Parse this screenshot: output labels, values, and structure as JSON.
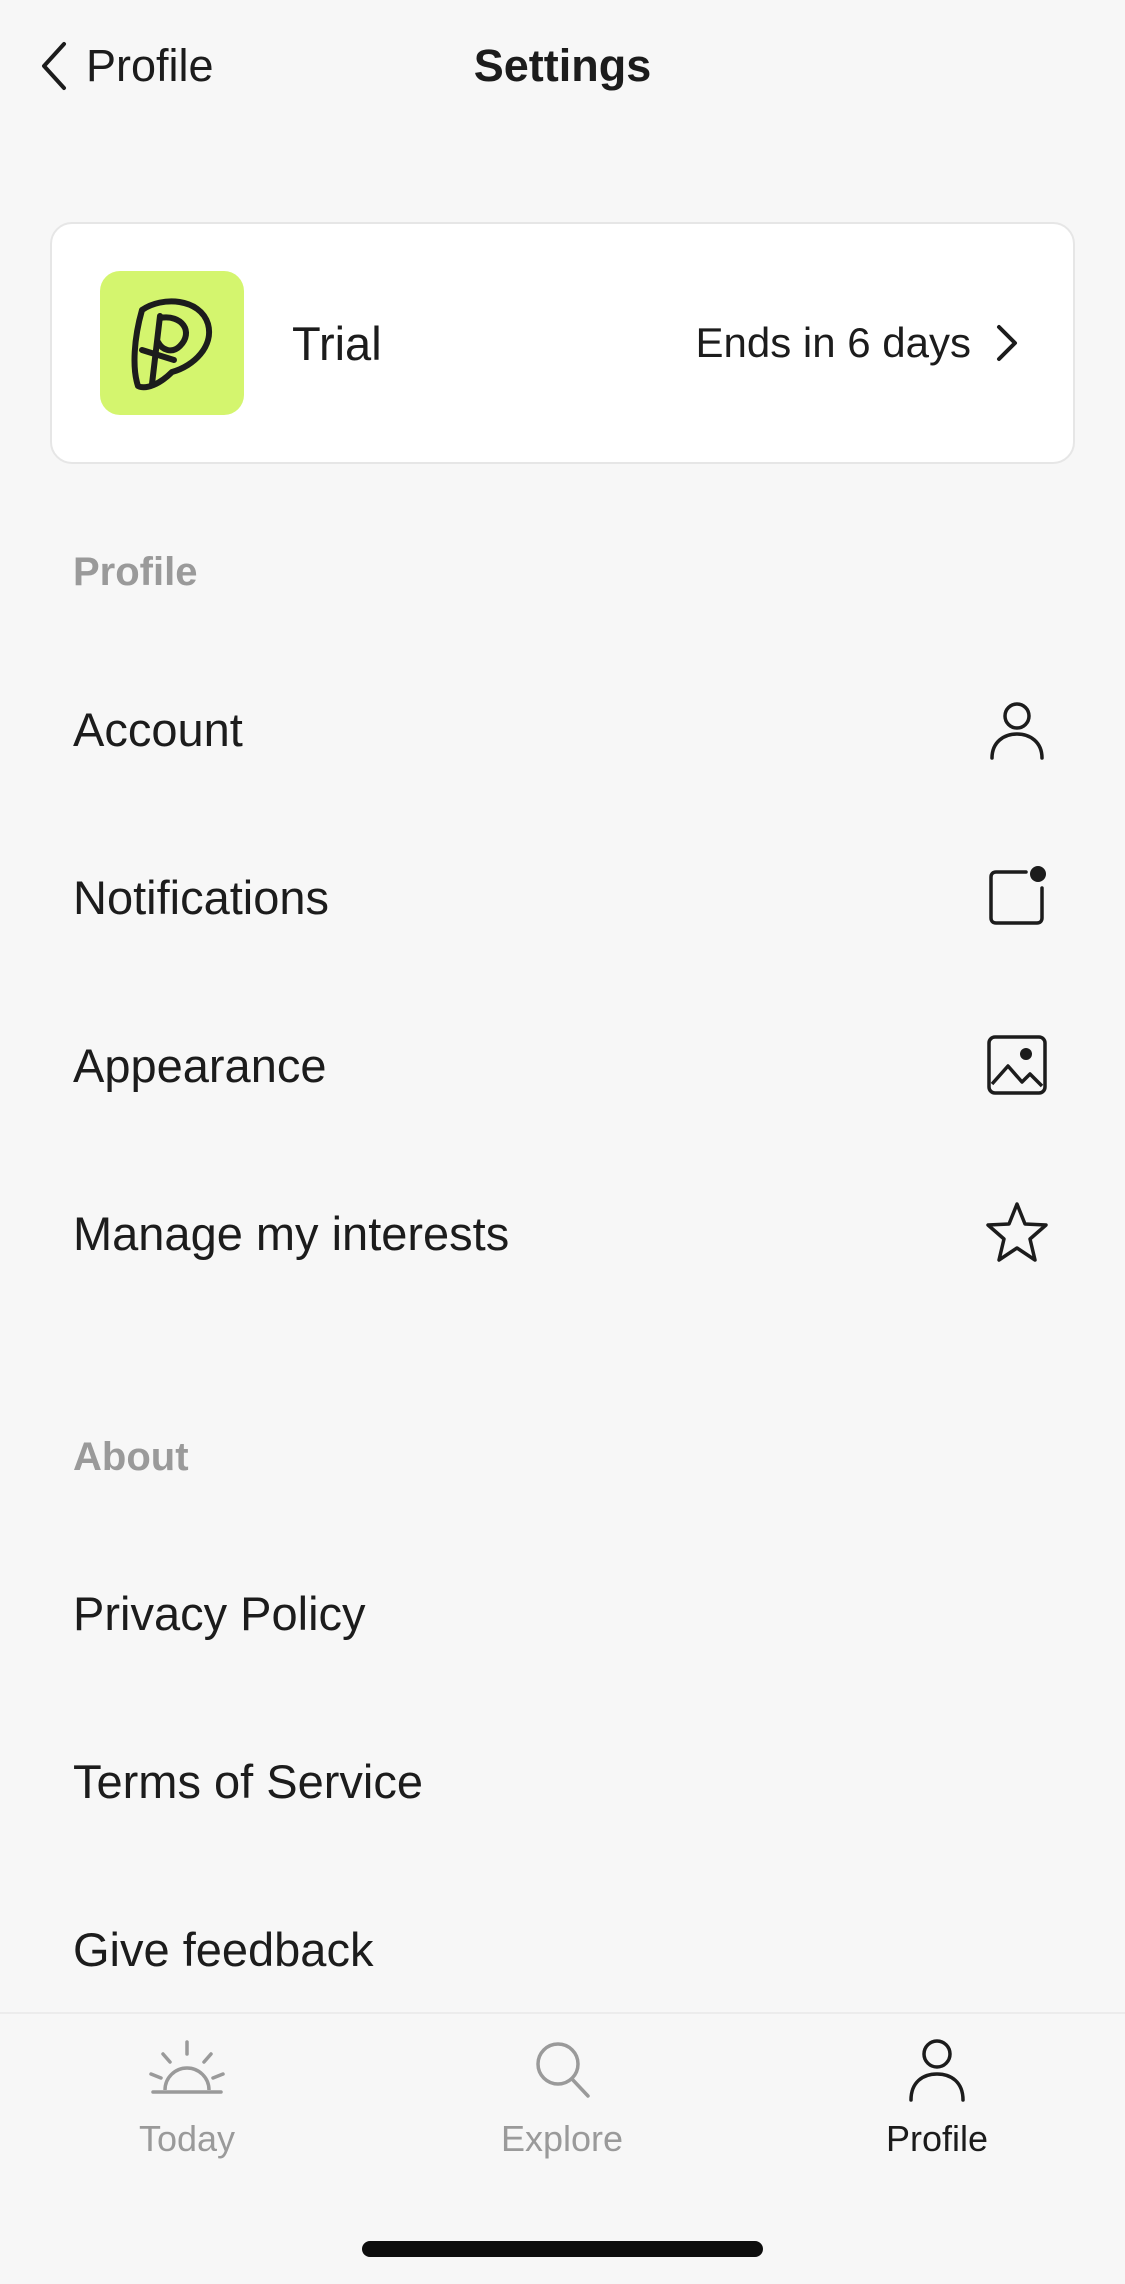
{
  "header": {
    "back_label": "Profile",
    "title": "Settings"
  },
  "trial": {
    "label": "Trial",
    "ends_text": "Ends in 6 days",
    "logo_color": "#d4f56e"
  },
  "sections": {
    "profile": {
      "label": "Profile",
      "items": [
        {
          "label": "Account",
          "icon": "person-icon"
        },
        {
          "label": "Notifications",
          "icon": "notification-icon"
        },
        {
          "label": "Appearance",
          "icon": "image-icon"
        },
        {
          "label": "Manage my interests",
          "icon": "star-icon"
        }
      ]
    },
    "about": {
      "label": "About",
      "items": [
        {
          "label": "Privacy Policy"
        },
        {
          "label": "Terms of Service"
        },
        {
          "label": "Give feedback"
        }
      ]
    }
  },
  "tabbar": {
    "tabs": [
      {
        "label": "Today",
        "icon": "sunrise-icon",
        "active": false
      },
      {
        "label": "Explore",
        "icon": "search-icon",
        "active": false
      },
      {
        "label": "Profile",
        "icon": "person-icon",
        "active": true
      }
    ]
  }
}
